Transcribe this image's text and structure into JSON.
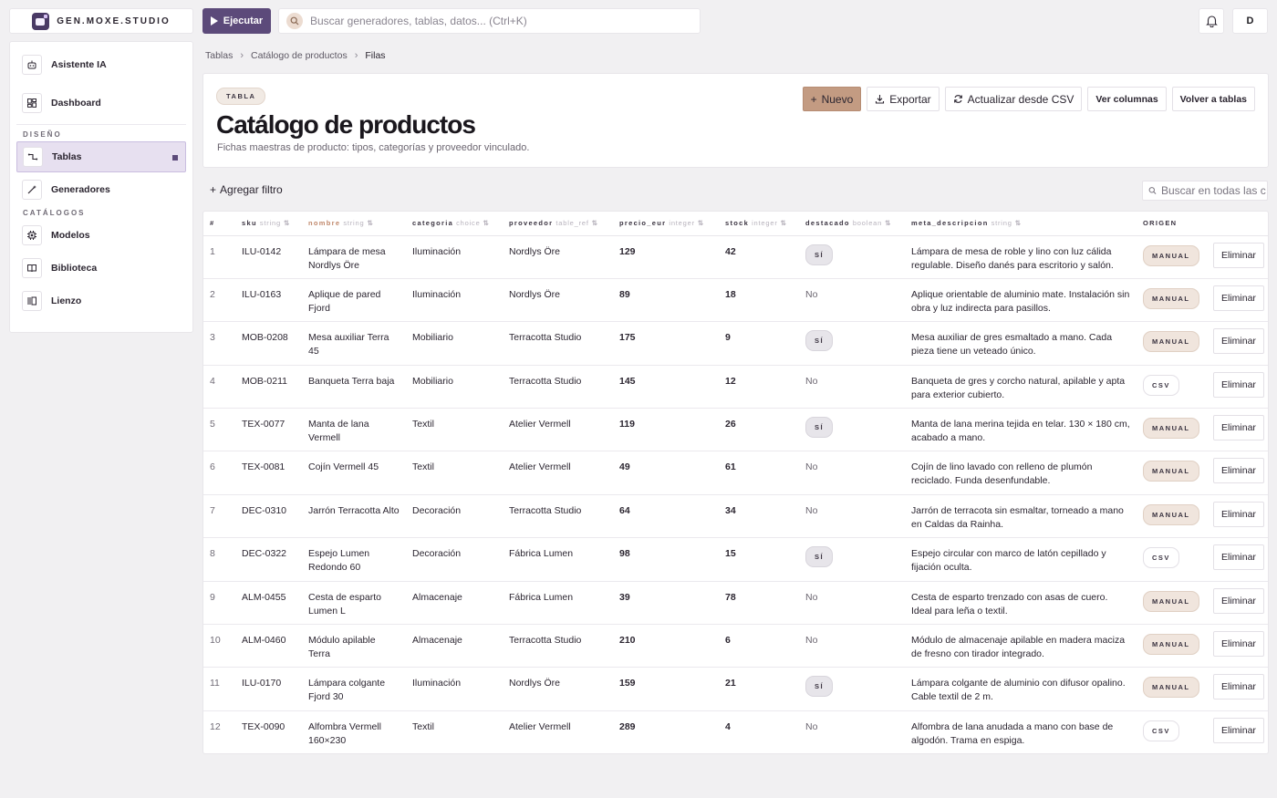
{
  "brand": {
    "name": "GEN.MOXE.STUDIO"
  },
  "topbar": {
    "run_label": "Ejecutar",
    "search_placeholder": "Buscar generadores, tablas, datos... (Ctrl+K)",
    "avatar_initial": "D",
    "icons": {
      "run": "play-icon",
      "search": "search-icon",
      "notifications": "bell-icon"
    }
  },
  "sidebar": {
    "top_items": [
      {
        "label": "Asistente IA",
        "icon": "robot-icon"
      },
      {
        "label": "Dashboard",
        "icon": "dashboard-icon"
      }
    ],
    "sections": [
      {
        "title": "DISEÑO",
        "items": [
          {
            "label": "Tablas",
            "icon": "tables-icon",
            "active": true
          },
          {
            "label": "Generadores",
            "icon": "wand-icon"
          }
        ]
      },
      {
        "title": "CATÁLOGOS",
        "items": [
          {
            "label": "Modelos",
            "icon": "chip-icon"
          },
          {
            "label": "Biblioteca",
            "icon": "book-icon"
          },
          {
            "label": "Lienzo",
            "icon": "canvas-icon"
          }
        ]
      }
    ]
  },
  "breadcrumb": [
    "Tablas",
    "Catálogo de productos",
    "Filas"
  ],
  "header": {
    "tag": "TABLA",
    "title": "Catálogo de productos",
    "subtitle": "Fichas maestras de producto: tipos, categorías y proveedor vinculado.",
    "buttons": {
      "new": "Nuevo",
      "export": "Exportar",
      "refresh": "Actualizar desde CSV",
      "columns": "Ver columnas",
      "back": "Volver a tablas"
    }
  },
  "filters": {
    "add_filter": "Agregar filtro",
    "search_placeholder": "Buscar en todas las c"
  },
  "table": {
    "columns": [
      {
        "name": "#",
        "type": ""
      },
      {
        "name": "sku",
        "type": "string"
      },
      {
        "name": "nombre",
        "type": "string",
        "sorted": true
      },
      {
        "name": "categoria",
        "type": "choice"
      },
      {
        "name": "proveedor",
        "type": "table_ref"
      },
      {
        "name": "precio_eur",
        "type": "integer"
      },
      {
        "name": "stock",
        "type": "integer"
      },
      {
        "name": "destacado",
        "type": "boolean"
      },
      {
        "name": "meta_descripcion",
        "type": "string"
      },
      {
        "name": "ORIGEN",
        "type": ""
      },
      {
        "name": "",
        "type": ""
      }
    ],
    "delete_label": "Eliminar",
    "rows": [
      {
        "idx": "1",
        "sku": "ILU-0142",
        "nombre": "Lámpara de mesa Nordlys Öre",
        "categoria": "Iluminación",
        "proveedor": "Nordlys Öre",
        "precio": "129",
        "stock": "42",
        "destacado": "SÍ",
        "desc": "Lámpara de mesa de roble y lino con luz cálida regulable. Diseño danés para escritorio y salón.",
        "origen": "MANUAL"
      },
      {
        "idx": "2",
        "sku": "ILU-0163",
        "nombre": "Aplique de pared Fjord",
        "categoria": "Iluminación",
        "proveedor": "Nordlys Öre",
        "precio": "89",
        "stock": "18",
        "destacado": "No",
        "desc": "Aplique orientable de aluminio mate. Instalación sin obra y luz indirecta para pasillos.",
        "origen": "MANUAL"
      },
      {
        "idx": "3",
        "sku": "MOB-0208",
        "nombre": "Mesa auxiliar Terra 45",
        "categoria": "Mobiliario",
        "proveedor": "Terracotta Studio",
        "precio": "175",
        "stock": "9",
        "destacado": "SÍ",
        "desc": "Mesa auxiliar de gres esmaltado a mano. Cada pieza tiene un veteado único.",
        "origen": "MANUAL"
      },
      {
        "idx": "4",
        "sku": "MOB-0211",
        "nombre": "Banqueta Terra baja",
        "categoria": "Mobiliario",
        "proveedor": "Terracotta Studio",
        "precio": "145",
        "stock": "12",
        "destacado": "No",
        "desc": "Banqueta de gres y corcho natural, apilable y apta para exterior cubierto.",
        "origen": "CSV"
      },
      {
        "idx": "5",
        "sku": "TEX-0077",
        "nombre": "Manta de lana Vermell",
        "categoria": "Textil",
        "proveedor": "Atelier Vermell",
        "precio": "119",
        "stock": "26",
        "destacado": "SÍ",
        "desc": "Manta de lana merina tejida en telar. 130 × 180 cm, acabado a mano.",
        "origen": "MANUAL"
      },
      {
        "idx": "6",
        "sku": "TEX-0081",
        "nombre": "Cojín Vermell 45",
        "categoria": "Textil",
        "proveedor": "Atelier Vermell",
        "precio": "49",
        "stock": "61",
        "destacado": "No",
        "desc": "Cojín de lino lavado con relleno de plumón reciclado. Funda desenfundable.",
        "origen": "MANUAL"
      },
      {
        "idx": "7",
        "sku": "DEC-0310",
        "nombre": "Jarrón Terracotta Alto",
        "categoria": "Decoración",
        "proveedor": "Terracotta Studio",
        "precio": "64",
        "stock": "34",
        "destacado": "No",
        "desc": "Jarrón de terracota sin esmaltar, torneado a mano en Caldas da Rainha.",
        "origen": "MANUAL"
      },
      {
        "idx": "8",
        "sku": "DEC-0322",
        "nombre": "Espejo Lumen Redondo 60",
        "categoria": "Decoración",
        "proveedor": "Fábrica Lumen",
        "precio": "98",
        "stock": "15",
        "destacado": "SÍ",
        "desc": "Espejo circular con marco de latón cepillado y fijación oculta.",
        "origen": "CSV"
      },
      {
        "idx": "9",
        "sku": "ALM-0455",
        "nombre": "Cesta de esparto Lumen L",
        "categoria": "Almacenaje",
        "proveedor": "Fábrica Lumen",
        "precio": "39",
        "stock": "78",
        "destacado": "No",
        "desc": "Cesta de esparto trenzado con asas de cuero. Ideal para leña o textil.",
        "origen": "MANUAL"
      },
      {
        "idx": "10",
        "sku": "ALM-0460",
        "nombre": "Módulo apilable Terra",
        "categoria": "Almacenaje",
        "proveedor": "Terracotta Studio",
        "precio": "210",
        "stock": "6",
        "destacado": "No",
        "desc": "Módulo de almacenaje apilable en madera maciza de fresno con tirador integrado.",
        "origen": "MANUAL"
      },
      {
        "idx": "11",
        "sku": "ILU-0170",
        "nombre": "Lámpara colgante Fjord 30",
        "categoria": "Iluminación",
        "proveedor": "Nordlys Öre",
        "precio": "159",
        "stock": "21",
        "destacado": "SÍ",
        "desc": "Lámpara colgante de aluminio con difusor opalino. Cable textil de 2 m.",
        "origen": "MANUAL"
      },
      {
        "idx": "12",
        "sku": "TEX-0090",
        "nombre": "Alfombra Vermell 160×230",
        "categoria": "Textil",
        "proveedor": "Atelier Vermell",
        "precio": "289",
        "stock": "4",
        "destacado": "No",
        "desc": "Alfombra de lana anudada a mano con base de algodón. Trama en espiga.",
        "origen": "CSV"
      }
    ]
  },
  "colors": {
    "accent": "#5c4a7a",
    "primary_button": "#c39b82",
    "background": "#f1f0f2"
  }
}
